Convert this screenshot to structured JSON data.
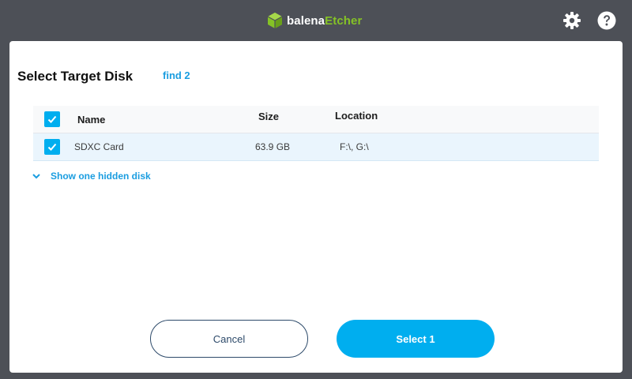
{
  "app": {
    "brand_part1": "balena",
    "brand_part2": "Etcher",
    "brand_color": "#85c226",
    "icons": [
      "settings-gear-icon",
      "help-question-icon"
    ]
  },
  "modal": {
    "title": "Select Target Disk",
    "find_label": "find 2",
    "table": {
      "columns": [
        "Name",
        "Size",
        "Location"
      ],
      "rows": [
        {
          "checked": true,
          "name": "SDXC Card",
          "size": "63.9 GB",
          "location": "F:\\, G:\\"
        }
      ],
      "select_all_checked": true
    },
    "hidden_disk_toggle": "Show one hidden disk",
    "cancel_label": "Cancel",
    "select_label": "Select 1"
  },
  "colors": {
    "background": "#4d5057",
    "accent": "#00aeef",
    "link": "#1a9de0",
    "selected_row": "#eaf5fd"
  }
}
